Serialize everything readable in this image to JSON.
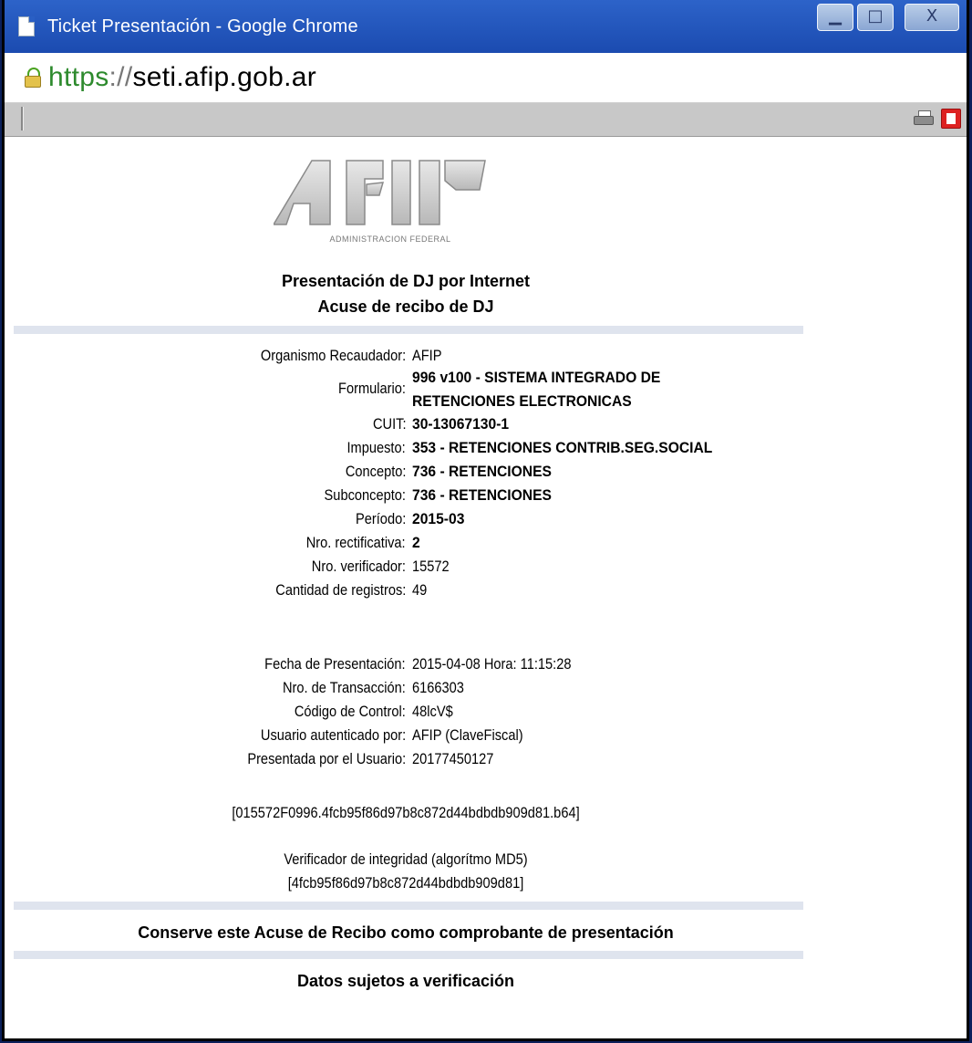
{
  "window": {
    "title": "Ticket Presentación - Google Chrome",
    "url_scheme": "https",
    "url_sep": "://",
    "url_host": "seti.afip.gob.ar",
    "minimize_glyph": "▁",
    "maximize_glyph": "□",
    "close_glyph": "X"
  },
  "logo": {
    "subtitle": "ADMINISTRACION FEDERAL"
  },
  "header": {
    "line1": "Presentación de DJ por Internet",
    "line2": "Acuse de recibo de DJ"
  },
  "fields": [
    {
      "label": "Organismo Recaudador:",
      "value": "AFIP",
      "bold": false
    },
    {
      "label": "Formulario:",
      "value_lines": [
        "996 v100 - SISTEMA INTEGRADO DE",
        "RETENCIONES ELECTRONICAS"
      ],
      "bold": true
    },
    {
      "label": "CUIT:",
      "value": "30-13067130-1",
      "bold": true
    },
    {
      "label": "Impuesto:",
      "value": "353 - RETENCIONES CONTRIB.SEG.SOCIAL",
      "bold": true
    },
    {
      "label": "Concepto:",
      "value": "736 - RETENCIONES",
      "bold": true
    },
    {
      "label": "Subconcepto:",
      "value": "736 - RETENCIONES",
      "bold": true
    },
    {
      "label": "Período:",
      "value": "2015-03",
      "bold": true
    },
    {
      "label": "Nro. rectificativa:",
      "value": "2",
      "bold": true
    },
    {
      "label": "Nro. verificador:",
      "value": "15572",
      "bold": false
    },
    {
      "label": "Cantidad de registros:",
      "value": "49",
      "bold": false
    }
  ],
  "submission": [
    {
      "label": "Fecha de Presentación:",
      "value": "2015-04-08 Hora: 11:15:28"
    },
    {
      "label": "Nro. de Transacción:",
      "value": "6166303"
    },
    {
      "label": "Código de Control:",
      "value": "48lcV$"
    },
    {
      "label": "Usuario autenticado por:",
      "value": "AFIP (ClaveFiscal)"
    },
    {
      "label": "Presentada por el Usuario:",
      "value": "20177450127"
    }
  ],
  "file_id": "[015572F0996.4fcb95f86d97b8c872d44bdbdb909d81.b64]",
  "integrity": {
    "label": "Verificador de integridad (algorítmo MD5)",
    "hash": "[4fcb95f86d97b8c872d44bdbdb909d81]"
  },
  "footer": {
    "keep_notice": "Conserve este Acuse de Recibo como comprobante de presentación",
    "verification_notice": "Datos sujetos a verificación"
  }
}
